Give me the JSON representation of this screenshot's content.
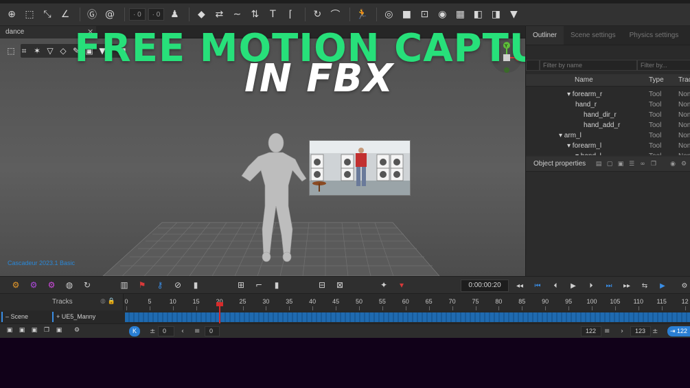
{
  "title_overlay": {
    "line1": "FREE MOTION CAPTURE",
    "line2": "IN FBX"
  },
  "tab": {
    "label": "dance",
    "close": "✕"
  },
  "viewport": {
    "version_label": "Cascadeur 2023.1 Basic"
  },
  "gizmo": {
    "y_label": "Y",
    "x_label": "X"
  },
  "outliner": {
    "tabs": [
      "Outliner",
      "Scene settings",
      "Physics settings"
    ],
    "filter_name_placeholder": "Filter by name",
    "filter_type_placeholder": "Filter by...",
    "columns": {
      "name": "Name",
      "type": "Type",
      "tracks": "Tracks"
    },
    "rows": [
      {
        "name": "▾ forearm_r",
        "type": "Tool",
        "tracks": "None",
        "indent": 1
      },
      {
        "name": "hand_r",
        "type": "Tool",
        "tracks": "None",
        "indent": 2
      },
      {
        "name": "hand_dir_r",
        "type": "Tool",
        "tracks": "None",
        "indent": 3
      },
      {
        "name": "hand_add_r",
        "type": "Tool",
        "tracks": "None",
        "indent": 3
      },
      {
        "name": "▾ arm_l",
        "type": "Tool",
        "tracks": "None",
        "indent": 0
      },
      {
        "name": "▾ forearm_l",
        "type": "Tool",
        "tracks": "None",
        "indent": 1
      },
      {
        "name": "▾ hand_l",
        "type": "Tool",
        "tracks": "None",
        "indent": 2
      }
    ]
  },
  "object_properties": {
    "title": "Object properties"
  },
  "playback": {
    "time": "0:00:00:20",
    "controls": [
      "◂◂",
      "⏮",
      "⏴",
      "▶",
      "⏵",
      "⏭",
      "▸▸"
    ]
  },
  "timeline": {
    "tracks_label": "Tracks",
    "ticks": [
      "0",
      "5",
      "10",
      "15",
      "20",
      "25",
      "30",
      "35",
      "40",
      "45",
      "50",
      "55",
      "60",
      "65",
      "70",
      "75",
      "80",
      "85",
      "90",
      "95",
      "100",
      "105",
      "110",
      "115",
      "12"
    ],
    "current_frame": 20,
    "scene_label": "Scene",
    "track_label": "UE5_Manny"
  },
  "footer": {
    "start_badge": "K",
    "start_value": "0",
    "frame_value": "0",
    "end_value_a": "122",
    "end_value_b": "123",
    "end_badge": "122"
  },
  "colors": {
    "title_green": "#27e07a",
    "title_white": "#ffffff",
    "accent_blue": "#2a7fd4",
    "playhead_red": "#d62b2b"
  }
}
